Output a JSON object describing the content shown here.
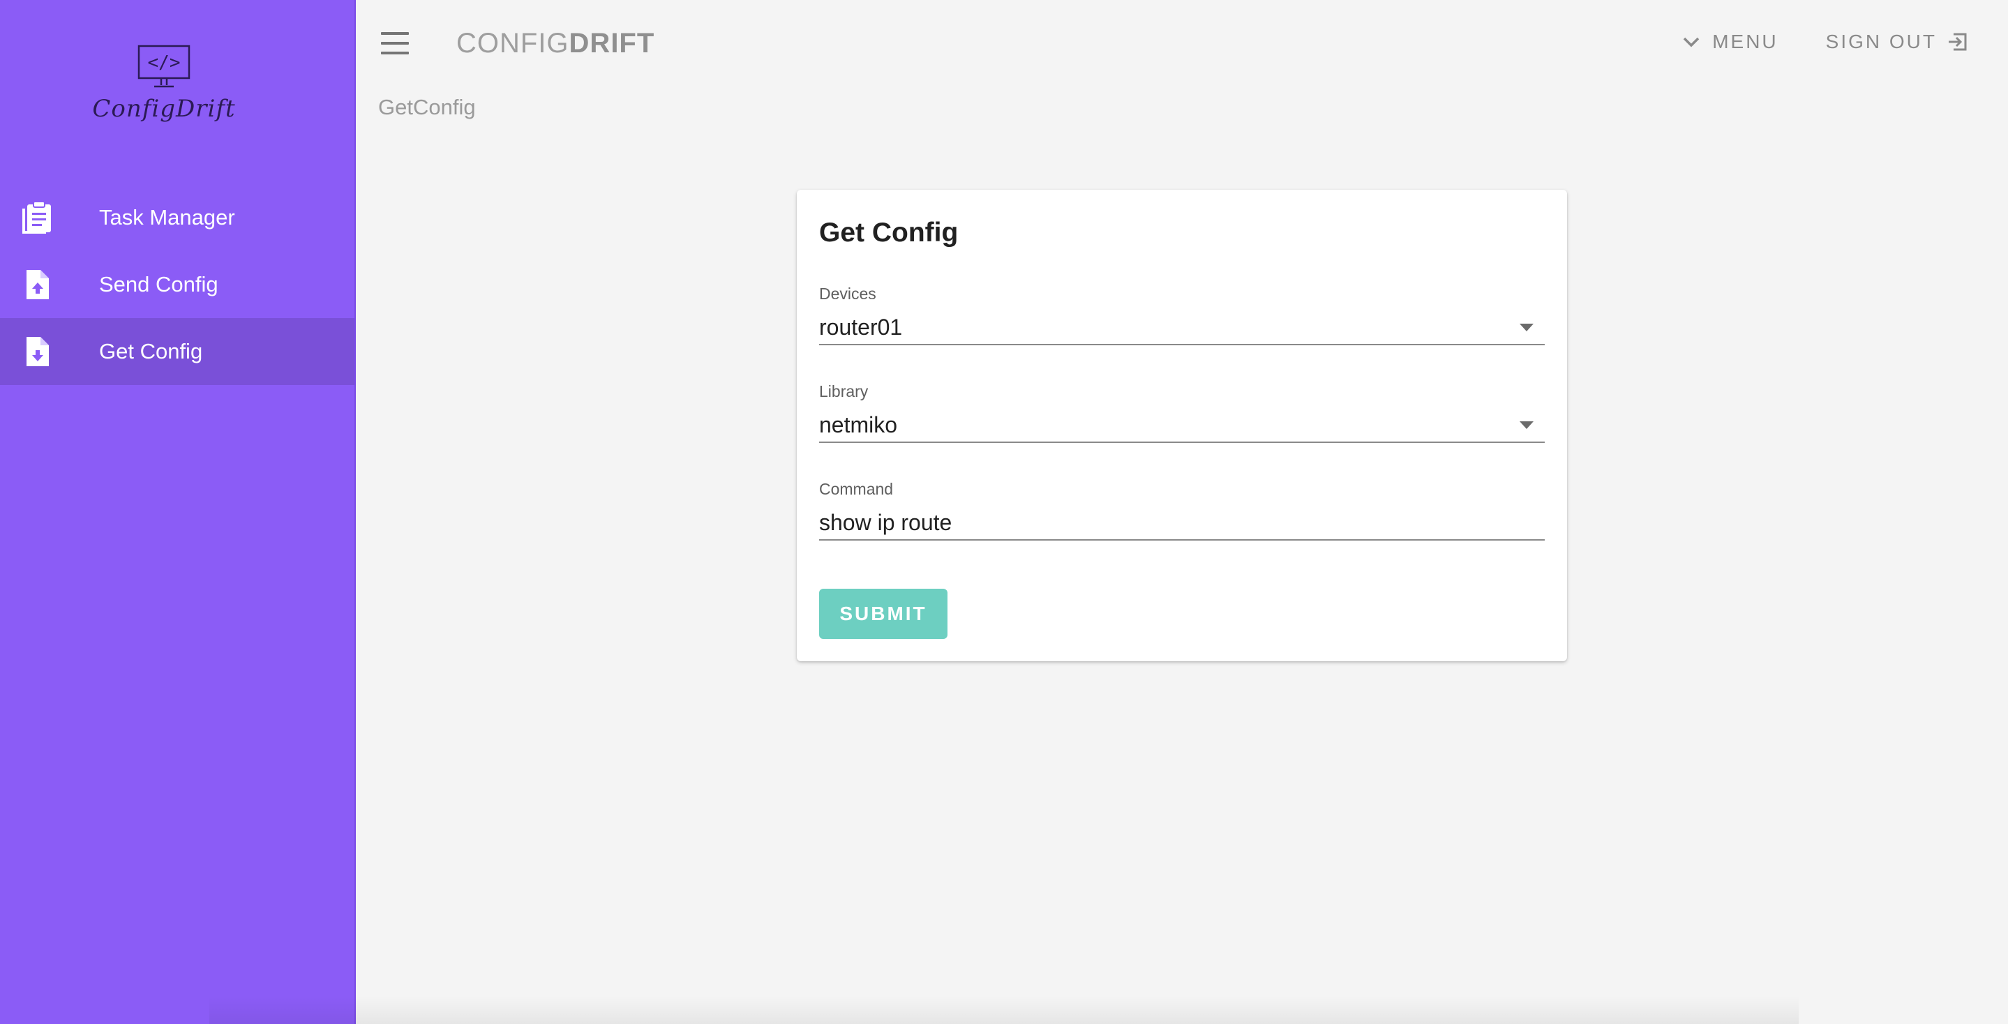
{
  "app": {
    "logo_text": "ConfigDrift",
    "brand_light": "CONFIG",
    "brand_bold": "DRIFT"
  },
  "colors": {
    "sidebar": "#8b5cf6",
    "submit": "#6dcfc1",
    "background": "#f4f4f4"
  },
  "sidebar": {
    "items": [
      {
        "label": "Task Manager",
        "icon": "clipboard-icon",
        "active": false
      },
      {
        "label": "Send Config",
        "icon": "file-upload-icon",
        "active": false
      },
      {
        "label": "Get Config",
        "icon": "file-download-icon",
        "active": true
      }
    ]
  },
  "header": {
    "menu_label": "MENU",
    "signout_label": "SIGN OUT"
  },
  "breadcrumb": "GetConfig",
  "form": {
    "title": "Get Config",
    "devices_label": "Devices",
    "devices_value": "router01",
    "library_label": "Library",
    "library_value": "netmiko",
    "command_label": "Command",
    "command_value": "show ip route",
    "submit_label": "SUBMIT"
  }
}
